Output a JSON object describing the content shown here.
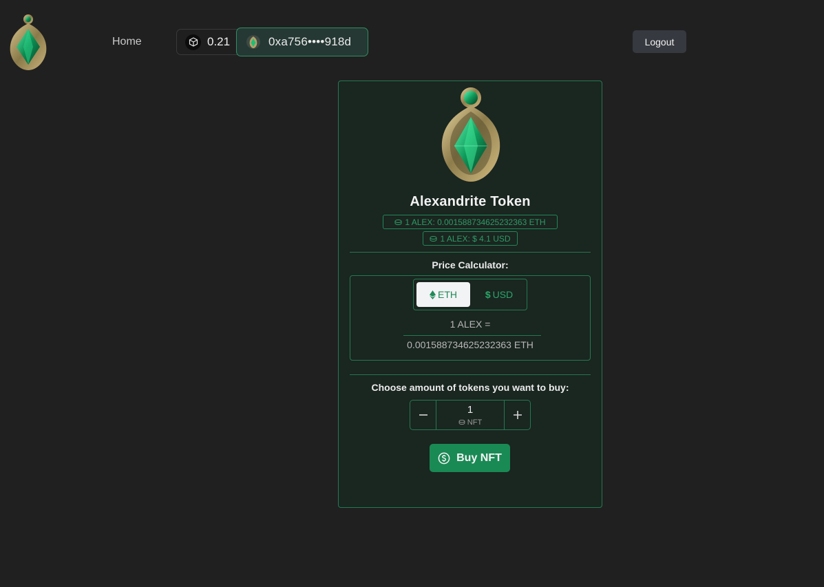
{
  "header": {
    "logo_icon": "alexandrite-gem-logo",
    "nav_home": "Home",
    "balance_icon": "cube-icon",
    "balance_value": "0.21",
    "account_icon": "gem-avatar",
    "account_address": "0xa756••••918d",
    "logout_label": "Logout"
  },
  "card": {
    "token_image_icon": "alexandrite-gem",
    "token_name": "Alexandrite Token",
    "price_eth": "1 ALEX: 0.001588734625232363 ETH",
    "price_usd": "1 ALEX: $ 4.1 USD",
    "calculator": {
      "label": "Price Calculator:",
      "toggle_eth": "ETH",
      "toggle_usd": "USD",
      "selected": "ETH",
      "line1": "1 ALEX =",
      "line2": "0.001588734625232363 ETH"
    },
    "purchase": {
      "label": "Choose amount of tokens you want to buy:",
      "quantity": "1",
      "unit": "NFT",
      "buy_label": "Buy NFT"
    }
  },
  "colors": {
    "background": "#202020",
    "card_background": "#1a2620",
    "accent_green": "#1a8a55",
    "border_green": "#237a52"
  }
}
